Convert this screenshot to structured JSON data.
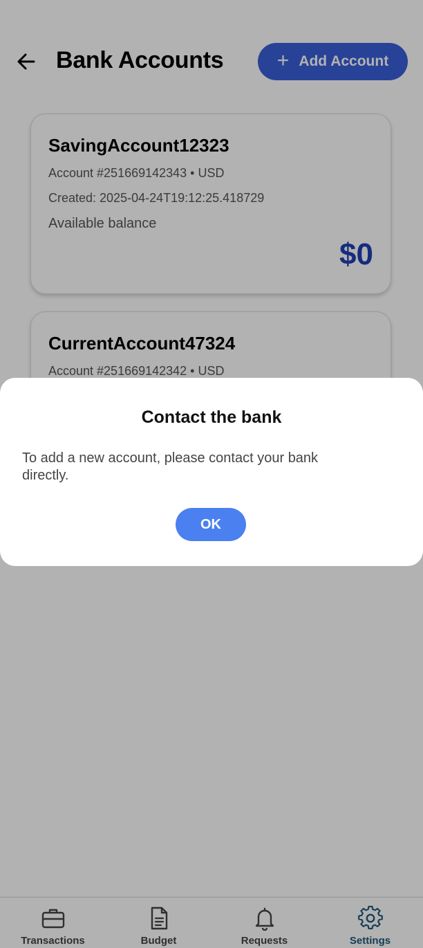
{
  "header": {
    "title": "Bank Accounts",
    "add_button_label": "Add Account",
    "add_button_icon": "plus-icon",
    "back_icon": "arrow-left-icon"
  },
  "accounts": [
    {
      "name": "SavingAccount12323",
      "meta": "Account #251669142343 • USD",
      "created": "Created: 2025-04-24T19:12:25.418729",
      "balance_label": "Available balance",
      "balance": "$0"
    },
    {
      "name": "CurrentAccount47324",
      "meta": "Account #251669142342 • USD"
    }
  ],
  "dialog": {
    "title": "Contact the bank",
    "message": "To add a new account, please contact your bank directly.",
    "ok_label": "OK"
  },
  "bottom_nav": {
    "items": [
      {
        "label": "Transactions",
        "icon": "briefcase-icon"
      },
      {
        "label": "Budget",
        "icon": "document-icon"
      },
      {
        "label": "Requests",
        "icon": "bell-icon"
      },
      {
        "label": "Settings",
        "icon": "gear-icon",
        "active": true
      }
    ]
  },
  "colors": {
    "accent": "#3a5fd9",
    "balance": "#1f3fb5",
    "ok_button": "#4a80f0",
    "active_nav": "#1f5a7a"
  }
}
